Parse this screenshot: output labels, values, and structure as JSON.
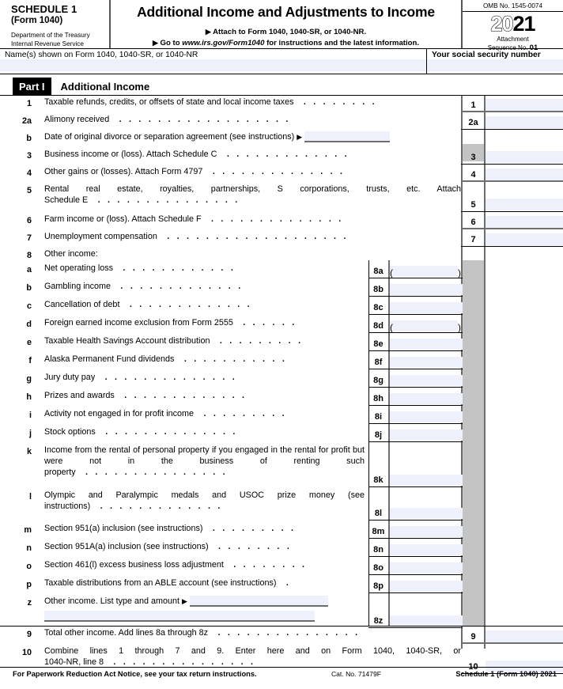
{
  "header": {
    "schedule": "SCHEDULE 1",
    "form": "(Form 1040)",
    "dept_line1": "Department of the Treasury",
    "dept_line2": "Internal Revenue Service",
    "title": "Additional Income and Adjustments to Income",
    "attach_note": "Attach to Form 1040, 1040-SR, or 1040-NR.",
    "goto_prefix": "Go to",
    "goto_url": "www.irs.gov/Form1040",
    "goto_suffix": "for instructions and the latest information.",
    "omb": "OMB No. 1545-0074",
    "year_hollow": "20",
    "year_solid": "21",
    "attachment_label": "Attachment",
    "sequence_label": "Sequence No.",
    "sequence_no": "01",
    "triangle": "▶"
  },
  "identity": {
    "name_label": "Name(s) shown on Form 1040, 1040-SR, or 1040-NR",
    "ssn_label": "Your social security number"
  },
  "part1": {
    "pill": "Part I",
    "title": "Additional Income"
  },
  "lines": [
    {
      "no": "1",
      "label": "Taxable refunds, credits, or offsets of state and local income taxes",
      "box": "1",
      "dots": 8
    },
    {
      "no": "2a",
      "label": "Alimony received",
      "box": "2a",
      "dots": 18
    },
    {
      "no": "b",
      "label": "Date of original divorce or separation agreement (see instructions)",
      "box": "",
      "writein": true
    },
    {
      "no": "3",
      "label": "Business income or (loss). Attach Schedule C",
      "box": "3",
      "dots": 13
    },
    {
      "no": "4",
      "label": "Other gains or (losses). Attach Form 4797",
      "box": "4",
      "dots": 14
    },
    {
      "no": "5",
      "label": "Rental real estate, royalties, partnerships, S corporations, trusts, etc. Attach",
      "label2": "Schedule E",
      "box": "5",
      "dots": 15,
      "two_line": true
    },
    {
      "no": "6",
      "label": "Farm income or (loss). Attach Schedule F",
      "box": "6",
      "dots": 14
    },
    {
      "no": "7",
      "label": "Unemployment compensation",
      "box": "7",
      "dots": 19
    },
    {
      "no": "8",
      "label": "Other income:",
      "box": "",
      "header_only": true
    }
  ],
  "other_income": [
    {
      "no": "a",
      "label": "Net operating loss",
      "box": "8a",
      "dots": 12,
      "negative": true
    },
    {
      "no": "b",
      "label": "Gambling income",
      "box": "8b",
      "dots": 13
    },
    {
      "no": "c",
      "label": "Cancellation of debt",
      "box": "8c",
      "dots": 13
    },
    {
      "no": "d",
      "label": "Foreign earned income exclusion from Form 2555",
      "box": "8d",
      "dots": 6,
      "negative": true
    },
    {
      "no": "e",
      "label": "Taxable Health Savings Account distribution",
      "box": "8e",
      "dots": 9
    },
    {
      "no": "f",
      "label": "Alaska Permanent Fund dividends",
      "box": "8f",
      "dots": 11
    },
    {
      "no": "g",
      "label": "Jury duty pay",
      "box": "8g",
      "dots": 14
    },
    {
      "no": "h",
      "label": "Prizes and awards",
      "box": "8h",
      "dots": 13
    },
    {
      "no": "i",
      "label": "Activity not engaged in for profit income",
      "box": "8i",
      "dots": 9
    },
    {
      "no": "j",
      "label": "Stock options",
      "box": "8j",
      "dots": 14
    },
    {
      "no": "k",
      "label": "Income from the rental of personal property if you engaged in the rental for profit but were not in the business of renting such",
      "label2": "property",
      "box": "8k",
      "dots": 15,
      "three_line": true
    },
    {
      "no": "l",
      "label": "Olympic and Paralympic medals and USOC prize money (see",
      "label2": "instructions)",
      "box": "8l",
      "dots": 13,
      "two_line": true
    },
    {
      "no": "m",
      "label": "Section 951(a) inclusion (see instructions)",
      "box": "8m",
      "dots": 9
    },
    {
      "no": "n",
      "label": "Section 951A(a) inclusion (see instructions)",
      "box": "8n",
      "dots": 8
    },
    {
      "no": "o",
      "label": "Section 461(l) excess business loss adjustment",
      "box": "8o",
      "dots": 8
    },
    {
      "no": "p",
      "label": "Taxable distributions from an ABLE account (see instructions)",
      "box": "8p",
      "dots": 1
    },
    {
      "no": "z",
      "label": "Other income. List type and amount",
      "box": "8z",
      "writein": true
    }
  ],
  "totals": [
    {
      "no": "9",
      "label": "Total other income. Add lines 8a through 8z",
      "box": "9",
      "dots": 15
    },
    {
      "no": "10",
      "label": "Combine lines 1 through 7 and 9. Enter here and on Form 1040, 1040-SR, or",
      "label2": "1040-NR, line 8",
      "box": "10",
      "dots": 15,
      "two_line": true
    }
  ],
  "footer": {
    "notice": "For Paperwork Reduction Act Notice, see your tax return instructions.",
    "cat": "Cat. No. 71479F",
    "right": "Schedule 1 (Form 1040) 2021"
  },
  "colors": {
    "field_fill": "#eef0fb",
    "blocked": "#c4c4c4",
    "rule": "#6e6e6e",
    "ink": "#000000"
  }
}
